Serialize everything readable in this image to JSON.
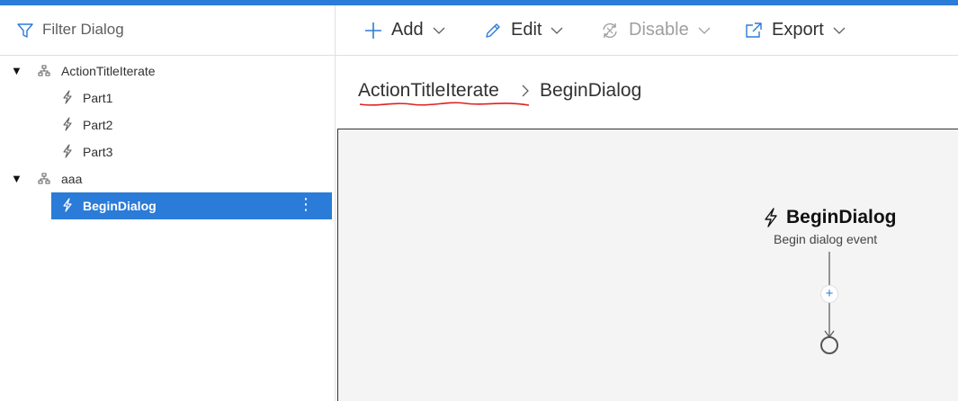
{
  "filter": {
    "label": "Filter Dialog"
  },
  "tree": {
    "groups": [
      {
        "label": "ActionTitleIterate",
        "items": [
          {
            "label": "Part1"
          },
          {
            "label": "Part2"
          },
          {
            "label": "Part3"
          }
        ]
      },
      {
        "label": "aaa",
        "items": [
          {
            "label": "BeginDialog",
            "selected": true
          }
        ]
      }
    ]
  },
  "toolbar": {
    "add_label": "Add",
    "edit_label": "Edit",
    "disable_label": "Disable",
    "export_label": "Export"
  },
  "breadcrumb": {
    "parent": "ActionTitleIterate",
    "current": "BeginDialog"
  },
  "canvas": {
    "node_title": "BeginDialog",
    "node_subtitle": "Begin dialog event",
    "add_symbol": "+"
  },
  "colors": {
    "accent": "#2b7bd8",
    "canvas_bg": "#f4f4f4"
  },
  "icons": [
    "filter-icon",
    "caret-down-icon",
    "dialog-tree-icon",
    "lightning-icon",
    "plus-icon",
    "pencil-icon",
    "refresh-icon",
    "export-icon",
    "chevron-down-icon",
    "chevron-right-icon"
  ]
}
